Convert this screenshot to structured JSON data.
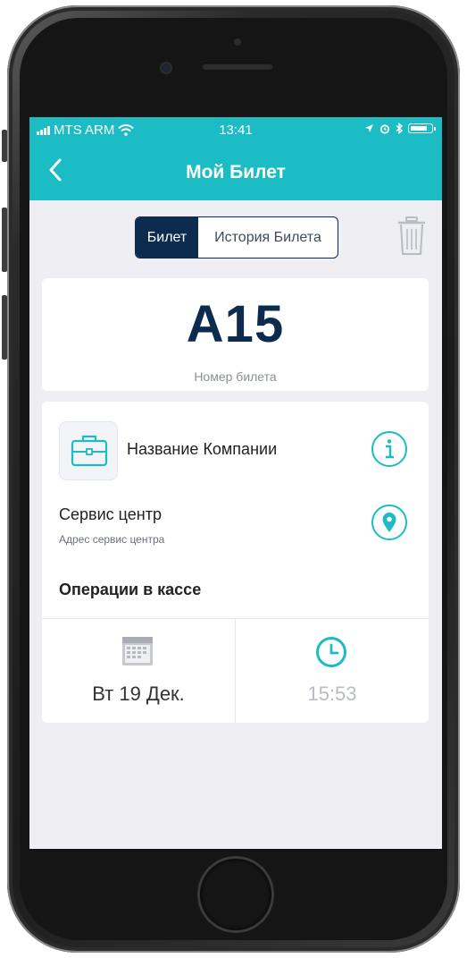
{
  "status_bar": {
    "carrier": "MTS ARM",
    "time": "13:41"
  },
  "nav": {
    "title": "Мой Билет"
  },
  "tabs": [
    {
      "label": "Билет",
      "active": true
    },
    {
      "label": "История Билета",
      "active": false
    }
  ],
  "ticket": {
    "number": "A15",
    "number_label": "Номер билета"
  },
  "details": {
    "company_name": "Название Компании",
    "service_title": "Сервис центр",
    "service_address": "Адрес сервис центра",
    "operations": "Операции в кассе",
    "date": "Вт 19 Дек.",
    "time": "15:53"
  },
  "colors": {
    "accent": "#1bbcc4",
    "navy": "#0d2b4e",
    "background": "#eeeef3"
  },
  "icons": [
    "back-chevron-icon",
    "trash-icon",
    "briefcase-icon",
    "info-icon",
    "location-pin-icon",
    "calendar-icon",
    "clock-icon",
    "wifi-icon",
    "signal-icon",
    "battery-icon",
    "location-arrow-icon",
    "alarm-icon",
    "bluetooth-icon"
  ]
}
